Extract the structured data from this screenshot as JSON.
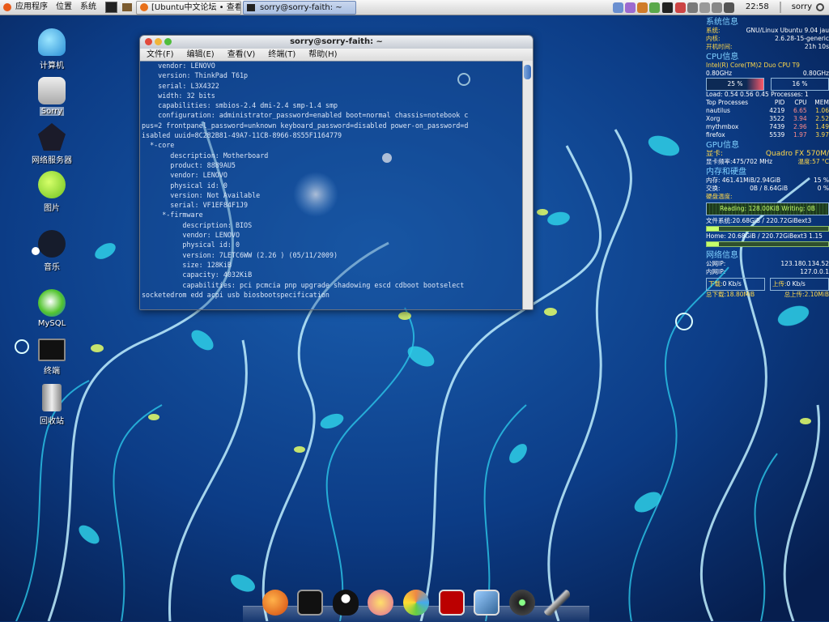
{
  "panel": {
    "menu": [
      "应用程序",
      "位置",
      "系统"
    ],
    "tasks": [
      {
        "label": "[Ubuntu中文论坛 • 查看...",
        "active": false
      },
      {
        "label": "sorry@sorry-faith: ~",
        "active": true
      }
    ],
    "clock": "22:58",
    "user": "sorry"
  },
  "desktop_icons": [
    "计算机",
    "Sorry",
    "网络服务器",
    "图片",
    "音乐",
    "MySQL",
    "终端",
    "回收站"
  ],
  "terminal": {
    "title": "sorry@sorry-faith: ~",
    "menu": [
      "文件(F)",
      "编辑(E)",
      "查看(V)",
      "终端(T)",
      "帮助(H)"
    ],
    "lines": [
      "    vendor: LENOVO",
      "    version: ThinkPad T61p",
      "    serial: L3X4322",
      "    width: 32 bits",
      "    capabilities: smbios-2.4 dmi-2.4 smp-1.4 smp",
      "    configuration: administrator_password=enabled boot=normal chassis=notebook c",
      "pus=2 frontpanel_password=unknown keyboard_password=disabled power-on_password=d",
      "isabled uuid=8C282B81-49A7-11CB-8966-8S55F1164779",
      "  *-core",
      "       description: Motherboard",
      "       product: 8889AU5",
      "       vendor: LENOVO",
      "       physical id: 0",
      "       version: Not Available",
      "       serial: VF1EF84F1J9",
      "     *-firmware",
      "          description: BIOS",
      "          vendor: LENOVO",
      "          physical id: 0",
      "          version: 7LETC6WW (2.26 ) (05/11/2009)",
      "          size: 128KiB",
      "          capacity: 4032KiB",
      "          capabilities: pci pcmcia pnp upgrade shadowing escd cdboot bootselect",
      "socketedrom edd acpi usb biosbootspecification"
    ]
  },
  "conky": {
    "sys_title": "系统信息",
    "os_label": "系统:",
    "os": "GNU/Linux Ubuntu 9.04 jau",
    "kernel_label": "内核:",
    "kernel": "2.6.28-15-generic",
    "uptime_label": "开机时间:",
    "uptime": "21h 10s",
    "cpu_title": "CPU信息",
    "cpu_name": "Intel(R) Core(TM)2 Duo CPU   T9",
    "freq1": "0.80GHz",
    "freq2": "0.80GHz",
    "cpu1": "25 %",
    "cpu2": "16 %",
    "load": "Load: 0.54 0.56 0.45  Processes: 1",
    "top_header": [
      "Top Processes",
      "PID",
      "CPU",
      "MEM"
    ],
    "top": [
      [
        "nautilus",
        "4219",
        "6.65",
        "1.06"
      ],
      [
        "Xorg",
        "3522",
        "3.94",
        "2.52"
      ],
      [
        "mythmbox",
        "7439",
        "2.96",
        "1.49"
      ],
      [
        "firefox",
        "5539",
        "1.97",
        "3.97"
      ]
    ],
    "gpu_title": "GPU信息",
    "gpu_label": "显卡:",
    "gpu": "Quadro FX 570M/",
    "gpu_freq": "显卡频率:475/702 MHz",
    "gpu_temp": "温度:57 °C",
    "mem_title": "内存和硬盘",
    "mem": "内存: 461.41MiB/2.94GiB",
    "mem_pct": "15 %",
    "swap_label": "交换:",
    "swap": "0B    / 8.64GiB",
    "swap_pct": "0 %",
    "disk_temp": "硬盘温度:",
    "io": "Reading: 128.00KiB Writing: 0B",
    "fs": "文件系统:20.68GiB / 220.72GiBext3",
    "home": "Home: 20.68GiB / 220.72GiBext3 1.15",
    "net_title": "网络信息",
    "pub_ip_label": "公网IP:",
    "pub_ip": "123.180.134.52",
    "lan_ip_label": "内网IP:",
    "lan_ip": "127.0.0.1",
    "down_label": "下载:",
    "down": "0  Kb/s",
    "up_label": "上传:",
    "up": "0  Kb/s",
    "down_total": "总下载:18.80MiB",
    "up_total": "总上传:2.10MiB"
  },
  "dock": [
    "firefox-icon",
    "terminal-icon",
    "qq-icon",
    "pidgin-icon",
    "flower-icon",
    "filezilla-icon",
    "virtualbox-icon",
    "media-icon",
    "knife-icon"
  ]
}
